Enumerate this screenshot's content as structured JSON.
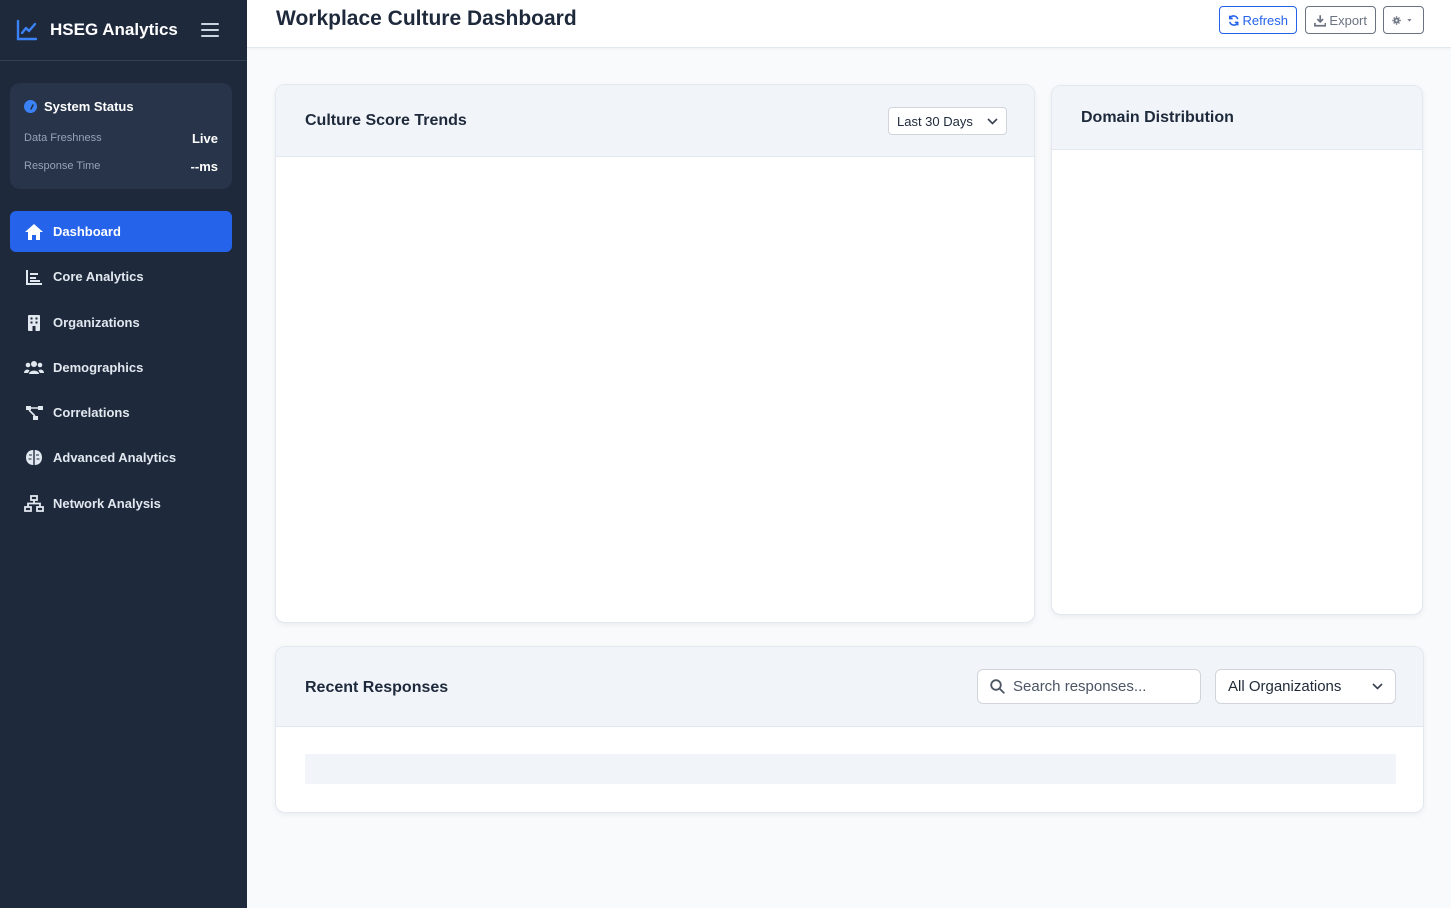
{
  "app": {
    "name": "HSEG Analytics"
  },
  "system_status": {
    "title": "System Status",
    "rows": [
      {
        "label": "Data Freshness",
        "value": "Live"
      },
      {
        "label": "Response Time",
        "value": "--ms"
      }
    ]
  },
  "nav": {
    "items": [
      {
        "label": "Dashboard",
        "icon": "home-icon",
        "active": true
      },
      {
        "label": "Core Analytics",
        "icon": "bar-chart-icon"
      },
      {
        "label": "Organizations",
        "icon": "building-icon"
      },
      {
        "label": "Demographics",
        "icon": "users-icon"
      },
      {
        "label": "Correlations",
        "icon": "project-diagram-icon"
      },
      {
        "label": "Advanced Analytics",
        "icon": "brain-icon"
      },
      {
        "label": "Network Analysis",
        "icon": "sitemap-icon"
      }
    ]
  },
  "header": {
    "title": "Workplace Culture Dashboard",
    "refresh_label": "Refresh",
    "export_label": "Export"
  },
  "trends": {
    "title": "Culture Score Trends",
    "range_selected": "Last 30 Days"
  },
  "domain": {
    "title": "Domain Distribution"
  },
  "recent": {
    "title": "Recent Responses",
    "search_placeholder": "Search responses...",
    "org_selected": "All Organizations"
  },
  "colors": {
    "sidebar_bg": "#1e293b",
    "accent": "#2563eb",
    "page_bg": "#f8fafc"
  }
}
